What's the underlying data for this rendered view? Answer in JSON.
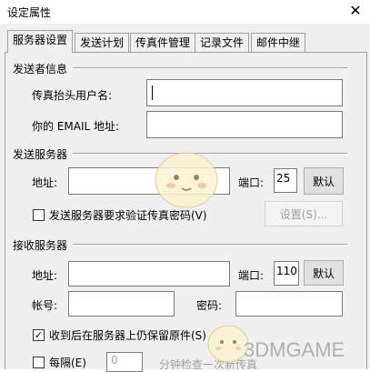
{
  "window": {
    "title": "设定属性",
    "close_glyph": "✕"
  },
  "tabs": [
    {
      "label": "服务器设置",
      "active": true
    },
    {
      "label": "发送计划",
      "active": false
    },
    {
      "label": "传真件管理",
      "active": false
    },
    {
      "label": "记录文件",
      "active": false
    },
    {
      "label": "邮件中继",
      "active": false
    }
  ],
  "sender_info": {
    "group_title": "发送者信息",
    "fax_header_label": "传真抬头用户名:",
    "fax_header_value": "",
    "email_label": "你的 EMAIL 地址:",
    "email_value": ""
  },
  "send_server": {
    "group_title": "发送服务器",
    "address_label": "地址:",
    "address_value": "",
    "port_label": "端口:",
    "port_value": "25",
    "default_button": "默认",
    "auth_checkbox_label": "发送服务器要求验证传真密码(V)",
    "auth_checked": false,
    "settings_button": "设置(S)..."
  },
  "receive_server": {
    "group_title": "接收服务器",
    "address_label": "地址:",
    "address_value": "",
    "port_label": "端口:",
    "port_value": "110",
    "default_button": "默认",
    "account_label": "帐号:",
    "account_value": "",
    "password_label": "密码:",
    "password_value": "",
    "keep_copy_label": "收到后在服务器上仍保留原件(S)",
    "keep_copy_checked": true,
    "check_every_label": "每隔(E)",
    "check_every_checked": false,
    "check_every_value": "0",
    "check_every_suffix": "分钟检查一次新传真"
  },
  "watermark": {
    "text": "3DMGAME"
  }
}
